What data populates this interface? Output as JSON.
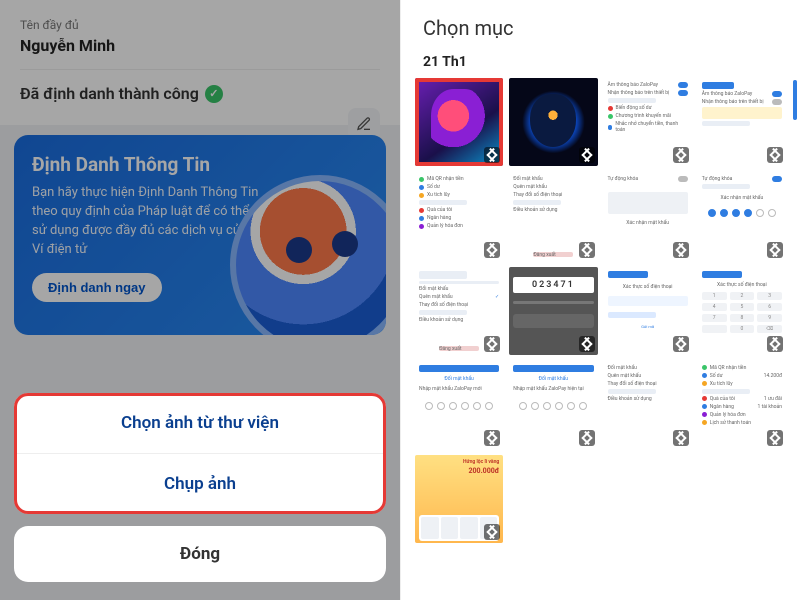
{
  "left": {
    "profile_title_label": "Tên đầy đủ",
    "profile_value": "Nguyễn Minh",
    "verified_text": "Đã định danh thành công",
    "banner": {
      "title": "Định Danh Thông Tin",
      "text": "Bạn hãy thực hiện Định Danh Thông Tin theo quy định của Pháp luật để có thể sử dụng được đầy đủ các dịch vụ của Ví điện tử",
      "button": "Định danh ngay"
    },
    "sheet": {
      "choose_from_library": "Chọn ảnh từ thư viện",
      "take_photo": "Chụp ảnh",
      "close": "Đóng"
    }
  },
  "right": {
    "title": "Chọn mục",
    "date": "21 Th1",
    "otp_code": "023471",
    "promo_text": "Hứng lộc lì vàng",
    "promo_amount": "200.000đ"
  }
}
